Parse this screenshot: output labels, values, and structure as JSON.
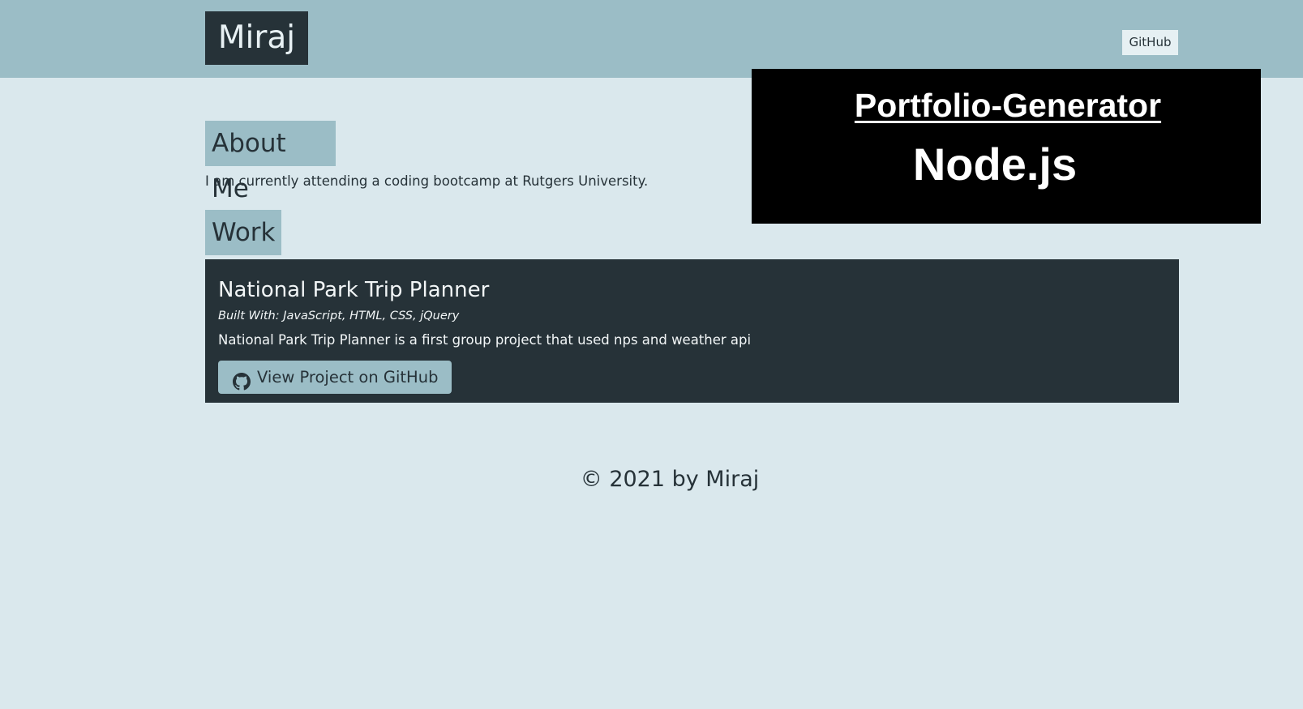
{
  "header": {
    "brand": "Miraj",
    "nav_link": "GitHub"
  },
  "banner": {
    "title": "Portfolio-Generator",
    "subtitle": "Node.js"
  },
  "about": {
    "heading": "About Me",
    "text": "I am currently attending a coding bootcamp at Rutgers University."
  },
  "work": {
    "heading": "Work",
    "project": {
      "title": "National Park Trip Planner",
      "built_with": "Built With: JavaScript, HTML, CSS, jQuery",
      "description": "National Park Trip Planner is a first group project that used nps and weather api",
      "button_label": "View Project on GitHub",
      "button_icon": "github-icon"
    }
  },
  "footer": {
    "text": "© 2021 by Miraj"
  },
  "colors": {
    "page_background": "#dae8ed",
    "header_background": "#9bbdc6",
    "dark": "#263238",
    "banner_background": "#000000"
  }
}
